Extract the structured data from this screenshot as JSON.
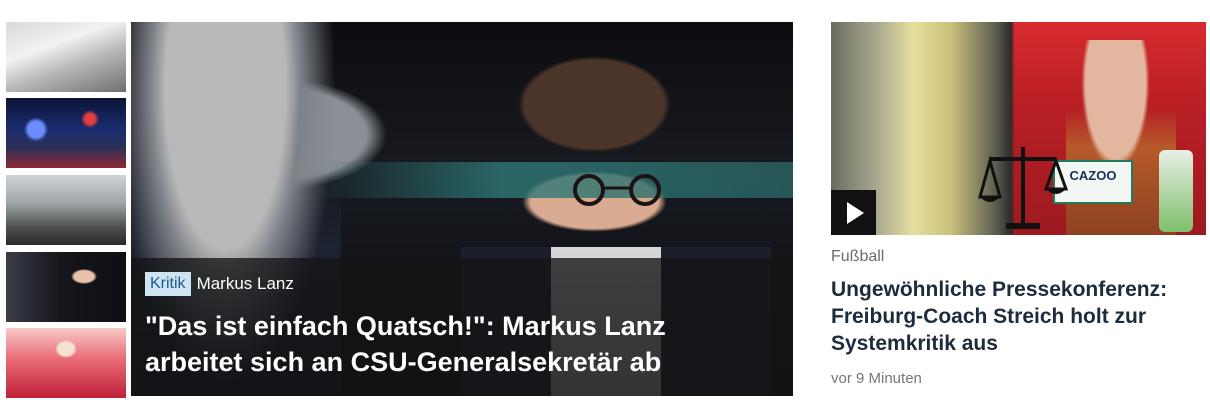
{
  "colors": {
    "accent": "#f4c400",
    "badge_bg": "#cfe4f2",
    "badge_fg": "#1a5c8a",
    "title_dark": "#1c2c3c"
  },
  "thumbnails": [
    {
      "name": "hand-disposing-mask",
      "active": false
    },
    {
      "name": "police-lights-night",
      "active": false
    },
    {
      "name": "soldiers-ruins",
      "active": false
    },
    {
      "name": "talkshow-guest",
      "active": true
    },
    {
      "name": "blonde-woman-red",
      "active": false
    }
  ],
  "hero": {
    "badge": "Kritik",
    "kicker": "Markus Lanz",
    "title": "\"Das ist einfach Quatsch!\": Markus Lanz arbeitet sich an CSU-Generalsekretär ab"
  },
  "side_article": {
    "image_text": {
      "cazoo": "CAZOO"
    },
    "play_icon": "play-icon",
    "category": "Fußball",
    "title": "Ungewöhnliche Pressekonferenz: Freiburg-Coach Streich holt zur Systemkritik aus",
    "time": "vor 9 Minuten"
  }
}
